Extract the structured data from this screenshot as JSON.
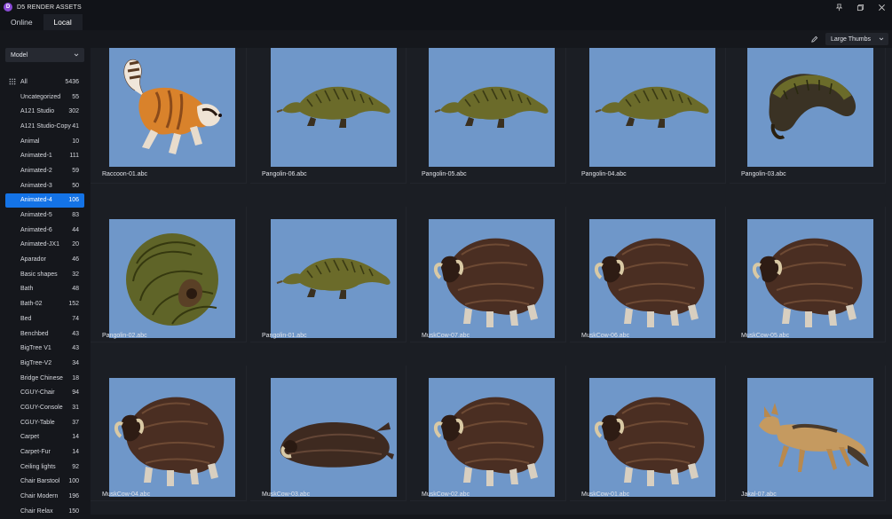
{
  "app": {
    "title": "D5 RENDER ASSETS",
    "logo_letter": "D"
  },
  "tabs": [
    {
      "label": "Online"
    },
    {
      "label": "Local"
    }
  ],
  "toolbar": {
    "view_mode": "Large Thumbs"
  },
  "sidebar": {
    "filter": "Model",
    "items": [
      {
        "label": "All",
        "count": "5436"
      },
      {
        "label": "Uncategorized",
        "count": "55"
      },
      {
        "label": "A121 Studio",
        "count": "302"
      },
      {
        "label": "A121 Studio-Copy",
        "count": "41"
      },
      {
        "label": "Animal",
        "count": "10"
      },
      {
        "label": "Animated-1",
        "count": "111"
      },
      {
        "label": "Animated-2",
        "count": "59"
      },
      {
        "label": "Animated-3",
        "count": "50"
      },
      {
        "label": "Animated-4",
        "count": "106"
      },
      {
        "label": "Animated-5",
        "count": "83"
      },
      {
        "label": "Animated-6",
        "count": "44"
      },
      {
        "label": "Animated-JX1",
        "count": "20"
      },
      {
        "label": "Aparador",
        "count": "46"
      },
      {
        "label": "Basic shapes",
        "count": "32"
      },
      {
        "label": "Bath",
        "count": "48"
      },
      {
        "label": "Bath-02",
        "count": "152"
      },
      {
        "label": "Bed",
        "count": "74"
      },
      {
        "label": "Benchbed",
        "count": "43"
      },
      {
        "label": "BigTree V1",
        "count": "43"
      },
      {
        "label": "BigTree-V2",
        "count": "34"
      },
      {
        "label": "Bridge Chinese",
        "count": "18"
      },
      {
        "label": "CGUY-Chair",
        "count": "94"
      },
      {
        "label": "CGUY-Console",
        "count": "31"
      },
      {
        "label": "CGUY-Table",
        "count": "37"
      },
      {
        "label": "Carpet",
        "count": "14"
      },
      {
        "label": "Carpet-Fur",
        "count": "14"
      },
      {
        "label": "Ceiling lights",
        "count": "92"
      },
      {
        "label": "Chair Barstool",
        "count": "100"
      },
      {
        "label": "Chair Modern",
        "count": "196"
      },
      {
        "label": "Chair Relax",
        "count": "150"
      }
    ],
    "active_index": 8
  },
  "assets": [
    {
      "name": "Raccoon-01.abc",
      "kind": "raccoon"
    },
    {
      "name": "Pangolin-06.abc",
      "kind": "pangolin"
    },
    {
      "name": "Pangolin-05.abc",
      "kind": "pangolin"
    },
    {
      "name": "Pangolin-04.abc",
      "kind": "pangolin"
    },
    {
      "name": "Pangolin-03.abc",
      "kind": "pangolin-curl"
    },
    {
      "name": "Pangolin-02.abc",
      "kind": "pangolin-ball"
    },
    {
      "name": "Pangolin-01.abc",
      "kind": "pangolin"
    },
    {
      "name": "MuskCow-07.abc",
      "kind": "muskox"
    },
    {
      "name": "MuskCow-06.abc",
      "kind": "muskox"
    },
    {
      "name": "MuskCow-05.abc",
      "kind": "muskox"
    },
    {
      "name": "MuskCow-04.abc",
      "kind": "muskox"
    },
    {
      "name": "MuskCow-03.abc",
      "kind": "muskox-lying"
    },
    {
      "name": "MuskCow-02.abc",
      "kind": "muskox"
    },
    {
      "name": "MuskCow-01.abc",
      "kind": "muskox"
    },
    {
      "name": "Jakal-07.abc",
      "kind": "jackal"
    }
  ],
  "colors": {
    "accent": "#1473e6",
    "thumb_background": "#6f97c9",
    "panel": "#1b1e24",
    "logo": "#8a4bd6"
  }
}
